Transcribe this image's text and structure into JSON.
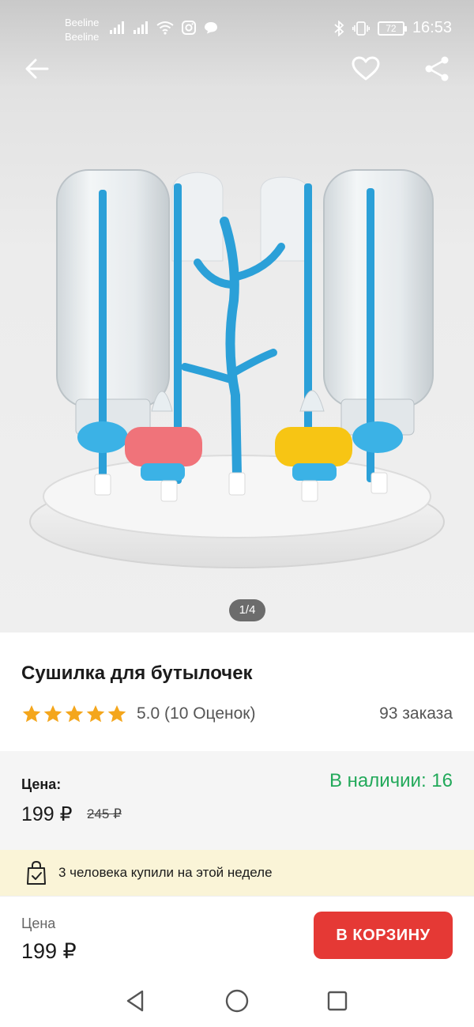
{
  "status_bar": {
    "carrier_1": "Beeline",
    "carrier_2": "Beeline",
    "battery": "72",
    "time": "16:53"
  },
  "gallery": {
    "pager": "1/4"
  },
  "product": {
    "title": "Сушилка для бутылочек",
    "rating_stars": 5,
    "rating_text": "5.0 (10 Оценок)",
    "orders": "93 заказа"
  },
  "price": {
    "label": "Цена:",
    "current": "199 ₽",
    "old": "245 ₽",
    "stock": "В наличии: 16"
  },
  "notice": {
    "text": "3 человека купили на этой неделе"
  },
  "buy_bar": {
    "label": "Цена",
    "price": "199 ₽",
    "cart_button": "В КОРЗИНУ"
  },
  "colors": {
    "accent_red": "#e53935",
    "stock_green": "#22a95a",
    "star_orange": "#f4a61c",
    "notice_bg": "#faf4d7"
  },
  "icons": {
    "back": "arrow-left-icon",
    "favorite": "heart-icon",
    "share": "share-icon",
    "notice": "shopping-bag-check-icon",
    "nav_back": "triangle-back-icon",
    "nav_home": "circle-home-icon",
    "nav_recent": "square-recent-icon"
  }
}
